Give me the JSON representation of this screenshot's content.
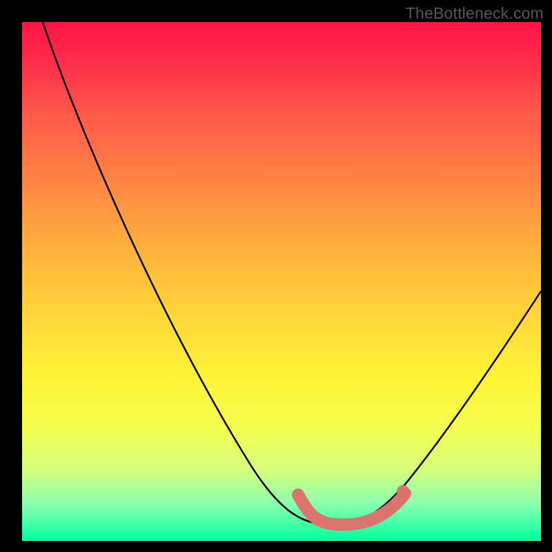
{
  "watermark": "TheBottleneck.com",
  "chart_data": {
    "type": "line",
    "title": "",
    "xlabel": "",
    "ylabel": "",
    "xlim": [
      0,
      100
    ],
    "ylim": [
      0,
      100
    ],
    "grid": false,
    "series": [
      {
        "name": "bottleneck-curve",
        "x": [
          4,
          10,
          20,
          30,
          40,
          50,
          55,
          58,
          60,
          62,
          65,
          70,
          73,
          75,
          80,
          90,
          100
        ],
        "y": [
          100,
          88,
          72,
          56,
          40,
          22,
          12,
          6,
          4,
          3,
          3,
          4,
          5,
          8,
          14,
          30,
          48
        ],
        "color": "#000000"
      }
    ],
    "highlight_band": {
      "x_range": [
        55,
        73
      ],
      "y_level": 3,
      "color": "#d9746e",
      "note": "low-bottleneck region (thick salmon overlay along valley floor)"
    },
    "colormap": {
      "type": "vertical-gradient",
      "stops": [
        {
          "pos": 0.0,
          "color": "#ff1447"
        },
        {
          "pos": 0.3,
          "color": "#ff8244"
        },
        {
          "pos": 0.55,
          "color": "#ffd23a"
        },
        {
          "pos": 0.78,
          "color": "#f6ff4e"
        },
        {
          "pos": 1.0,
          "color": "#00ff9c"
        }
      ]
    }
  }
}
